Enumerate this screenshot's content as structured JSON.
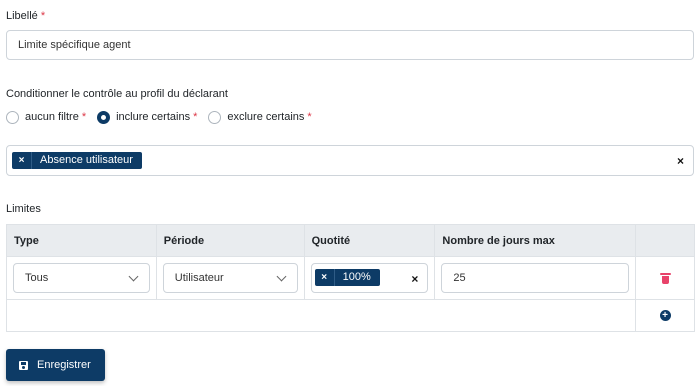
{
  "libelle": {
    "label": "Libellé",
    "required_mark": "*",
    "value": "Limite spécifique agent"
  },
  "condition": {
    "label": "Conditionner le contrôle au profil du déclarant",
    "options": [
      {
        "label": "aucun filtre",
        "required_mark": "*",
        "checked": false
      },
      {
        "label": "inclure certains",
        "required_mark": "*",
        "checked": true
      },
      {
        "label": "exclure certains",
        "required_mark": "*",
        "checked": false
      }
    ],
    "selected_profiles": [
      "Absence utilisateur"
    ],
    "chip_remove": "×",
    "clear_all": "×"
  },
  "limites": {
    "label": "Limites",
    "columns": [
      "Type",
      "Période",
      "Quotité",
      "Nombre de jours max"
    ],
    "rows": [
      {
        "type": "Tous",
        "periode": "Utilisateur",
        "quotite": "100%",
        "quotite_remove": "×",
        "quotite_clear": "×",
        "jours_max": "25"
      }
    ],
    "delete_icon": "trash-icon",
    "add_icon": "plus-circle-icon",
    "add_symbol": "+"
  },
  "save_button": {
    "label": "Enregistrer",
    "icon": "floppy-disk-icon"
  },
  "colors": {
    "primary": "#0d3b66",
    "danger": "#dc3545",
    "trash": "#e8436a"
  }
}
